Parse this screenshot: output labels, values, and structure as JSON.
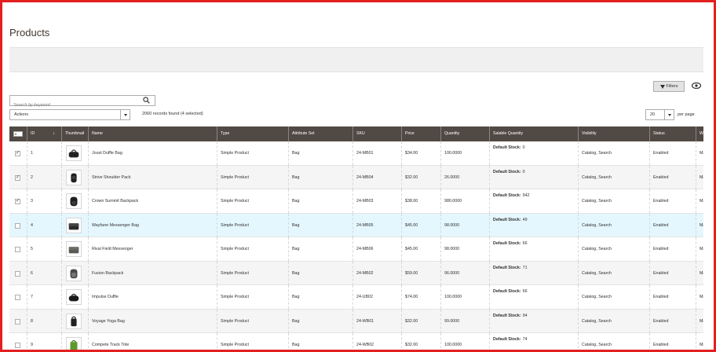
{
  "page": {
    "title": "Products"
  },
  "toolbar": {
    "filters_label": "Filters",
    "search_placeholder": "Search by keyword",
    "actions_label": "Actions",
    "records_text": "2060 records found (4 selected)",
    "per_page_value": "20",
    "per_page_label": "per page"
  },
  "grid": {
    "columns": [
      "ID",
      "Thumbnail",
      "Name",
      "Type",
      "Attribute Set",
      "SKU",
      "Price",
      "Quantity",
      "Salable Quantity",
      "Visibility",
      "Status",
      "We"
    ],
    "stock_label": "Default Stock:",
    "rows": [
      {
        "checked": true,
        "id": "1",
        "name": "Joust Duffle Bag",
        "type": "Simple Product",
        "attr": "Bag",
        "sku": "24-MB01",
        "price": "$34.00",
        "qty": "100.0000",
        "salable": "0",
        "visibility": "Catalog, Search",
        "status": "Enabled",
        "web": "Ma",
        "thumb": "duffle"
      },
      {
        "checked": true,
        "id": "2",
        "name": "Strive Shoulder Pack",
        "type": "Simple Product",
        "attr": "Bag",
        "sku": "24-MB04",
        "price": "$32.00",
        "qty": "26.0000",
        "salable": "0",
        "visibility": "Catalog, Search",
        "status": "Enabled",
        "web": "Ma",
        "thumb": "shoulder"
      },
      {
        "checked": true,
        "id": "3",
        "name": "Crown Summit Backpack",
        "type": "Simple Product",
        "attr": "Bag",
        "sku": "24-MB03",
        "price": "$38.00",
        "qty": "980.0000",
        "salable": "942",
        "visibility": "Catalog, Search",
        "status": "Enabled",
        "web": "Ma",
        "thumb": "backpack"
      },
      {
        "checked": false,
        "id": "4",
        "name": "Wayfarer Messenger Bag",
        "type": "Simple Product",
        "attr": "Bag",
        "sku": "24-MB05",
        "price": "$45.00",
        "qty": "98.0000",
        "salable": "49",
        "visibility": "Catalog, Search",
        "status": "Enabled",
        "web": "Ma",
        "thumb": "messenger"
      },
      {
        "checked": false,
        "id": "5",
        "name": "Rival Field Messenger",
        "type": "Simple Product",
        "attr": "Bag",
        "sku": "24-MB06",
        "price": "$45.00",
        "qty": "98.0000",
        "salable": "66",
        "visibility": "Catalog, Search",
        "status": "Enabled",
        "web": "Ma",
        "thumb": "field"
      },
      {
        "checked": false,
        "id": "6",
        "name": "Fusion Backpack",
        "type": "Simple Product",
        "attr": "Bag",
        "sku": "24-MB02",
        "price": "$59.00",
        "qty": "96.0000",
        "salable": "71",
        "visibility": "Catalog, Search",
        "status": "Enabled",
        "web": "Ma",
        "thumb": "fusion"
      },
      {
        "checked": false,
        "id": "7",
        "name": "Impulse Duffle",
        "type": "Simple Product",
        "attr": "Bag",
        "sku": "24-UB02",
        "price": "$74.00",
        "qty": "100.0000",
        "salable": "66",
        "visibility": "Catalog, Search",
        "status": "Enabled",
        "web": "Ma",
        "thumb": "impulse"
      },
      {
        "checked": false,
        "id": "8",
        "name": "Voyage Yoga Bag",
        "type": "Simple Product",
        "attr": "Bag",
        "sku": "24-WB01",
        "price": "$32.00",
        "qty": "99.0000",
        "salable": "94",
        "visibility": "Catalog, Search",
        "status": "Enabled",
        "web": "Ma",
        "thumb": "yoga"
      },
      {
        "checked": false,
        "id": "9",
        "name": "Compete Track Tote",
        "type": "Simple Product",
        "attr": "Bag",
        "sku": "24-WB02",
        "price": "$32.00",
        "qty": "100.0000",
        "salable": "74",
        "visibility": "Catalog, Search",
        "status": "Enabled",
        "web": "Ma",
        "thumb": "tote"
      }
    ]
  },
  "colors": {
    "header_bg": "#514943",
    "highlight_row": "#e5f7fe",
    "frame": "#e3201f"
  }
}
